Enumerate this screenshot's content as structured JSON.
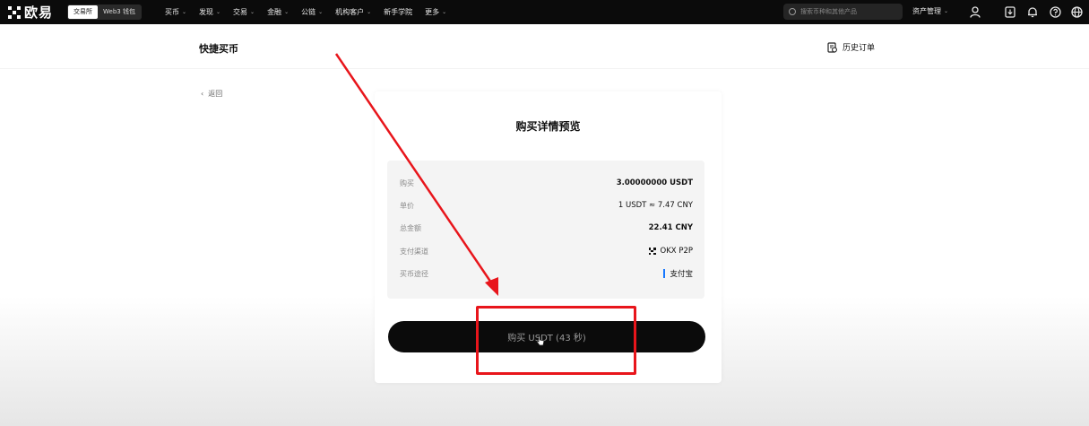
{
  "nav": {
    "logo_text": "欧易",
    "mode_tabs": [
      "交易所",
      "Web3 钱包"
    ],
    "items": [
      "买币",
      "发现",
      "交易",
      "金融",
      "公链",
      "机构客户",
      "新手学院",
      "更多"
    ],
    "items_with_chevron": [
      true,
      true,
      true,
      true,
      true,
      true,
      false,
      true
    ],
    "search_placeholder": "搜索币种和其他产品",
    "assets_label": "资产管理"
  },
  "page": {
    "title": "快捷买币",
    "history_label": "历史订单",
    "back_label": "返回"
  },
  "card": {
    "title": "购买详情预览",
    "rows": [
      {
        "label": "购买",
        "value": "3.00000000 USDT"
      },
      {
        "label": "单价",
        "value": "1 USDT ≈ 7.47 CNY"
      },
      {
        "label": "总金额",
        "value": "22.41 CNY"
      },
      {
        "label": "支付渠道",
        "value": "OKX P2P"
      },
      {
        "label": "买币途径",
        "value": "支付宝"
      }
    ],
    "buy_button_label": "购买 USDT (43 秒)"
  },
  "colors": {
    "nav_bg": "#0b0b0b",
    "annotation_red": "#e8151b",
    "alipay_blue": "#1677ff"
  }
}
